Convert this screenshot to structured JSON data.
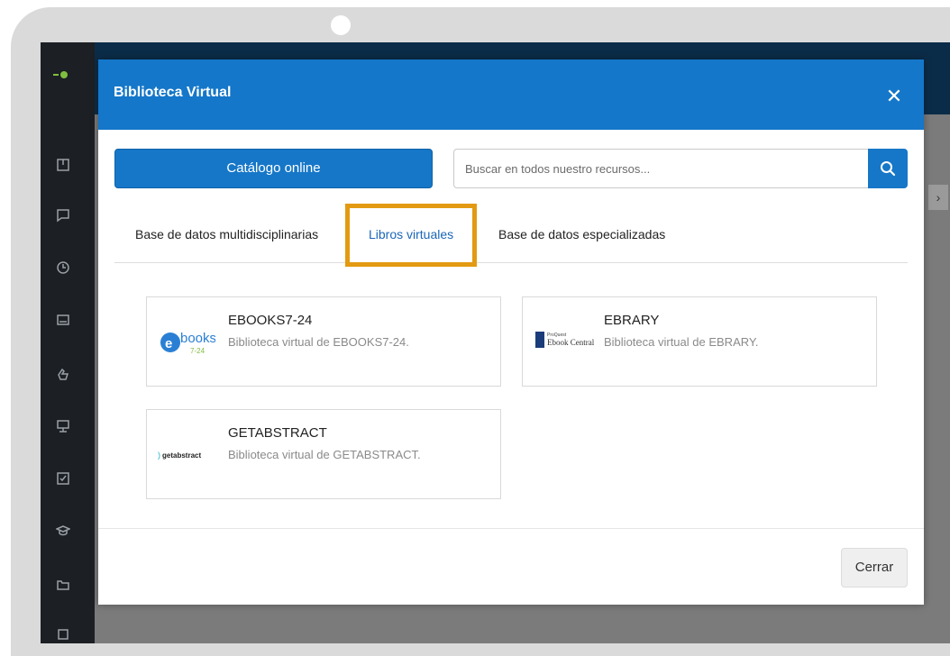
{
  "modal": {
    "title": "Biblioteca Virtual",
    "close_symbol": "✕",
    "catalog_button": "Catálogo online",
    "search_placeholder": "Buscar en todos nuestro recursos...",
    "footer_close_label": "Cerrar"
  },
  "tabs": [
    {
      "label": "Base de datos multidisciplinarias",
      "active": false
    },
    {
      "label": "Libros virtuales",
      "active": true
    },
    {
      "label": "Base de datos especializadas",
      "active": false
    }
  ],
  "cards": [
    {
      "title": "EBOOKS7-24",
      "description": "Biblioteca virtual de EBOOKS7-24.",
      "logo": "ebooks-logo"
    },
    {
      "title": "EBRARY",
      "description": "Biblioteca virtual de EBRARY.",
      "logo": "ebook-central-logo"
    },
    {
      "title": "GETABSTRACT",
      "description": "Biblioteca virtual de GETABSTRACT.",
      "logo": "getabstract-logo"
    }
  ],
  "logos": {
    "ebooks_text": "books",
    "ebooks_sub": "7-24",
    "ebook_central_small": "ProQuest",
    "ebook_central_text": "Ebook Central",
    "getabstract_text": "getabstract"
  },
  "app": {
    "chevron": "›"
  },
  "colors": {
    "header_blue": "#1477c9",
    "highlight_orange": "#e39a12",
    "active_tab": "#1a66b8",
    "sidebar_dark": "#1c1f24"
  }
}
